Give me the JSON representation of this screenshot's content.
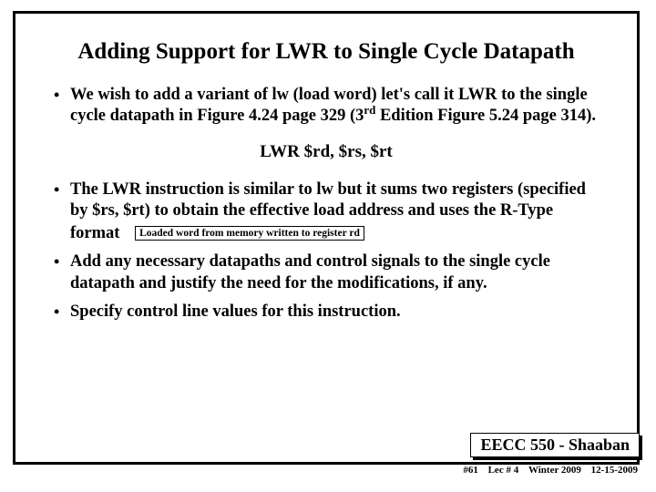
{
  "slide": {
    "title": "Adding Support for LWR to Single Cycle Datapath",
    "bullet1_pre": "We wish to add  a variant of lw (load word)  let's call it LWR to the single cycle datapath in Figure 4.24 page 329 (3",
    "bullet1_sup": "rd",
    "bullet1_post": " Edition Figure 5.24 page 314).",
    "code_line": "LWR   $rd, $rs,  $rt",
    "bullet2_line1": "The LWR instruction is similar to lw but it sums two registers (specified by $rs, $rt) to obtain the effective load address and uses the R-Type format",
    "inline_note": "Loaded word from memory written to register rd",
    "bullet3": "Add any necessary datapaths and control signals to the single cycle datapath and justify the need for the modifications, if any.",
    "bullet4": "Specify control line values for this instruction.",
    "footer_course": "EECC 550 - Shaaban",
    "footer_page": "#61",
    "footer_lec": "Lec # 4",
    "footer_term": "Winter 2009",
    "footer_date": "12-15-2009"
  }
}
